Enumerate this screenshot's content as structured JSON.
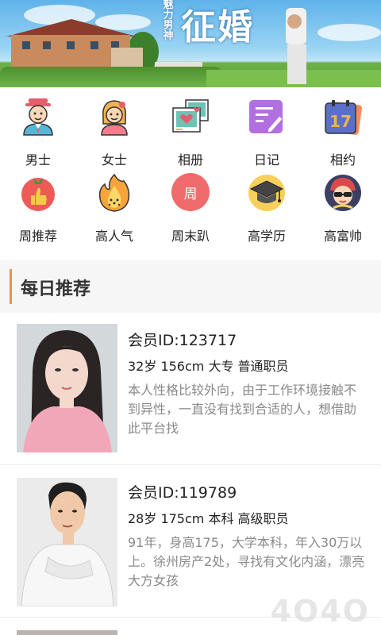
{
  "banner": {
    "subtitle": "魅力男神",
    "title": "征婚"
  },
  "categories": [
    {
      "label": "男士",
      "icon": "man-icon"
    },
    {
      "label": "女士",
      "icon": "woman-icon"
    },
    {
      "label": "相册",
      "icon": "photo-album-icon"
    },
    {
      "label": "日记",
      "icon": "diary-icon"
    },
    {
      "label": "相约",
      "icon": "date-calendar-icon"
    },
    {
      "label": "周推荐",
      "icon": "thumbs-up-tomato-icon"
    },
    {
      "label": "高人气",
      "icon": "popular-flame-icon"
    },
    {
      "label": "周末趴",
      "icon": "weekend-party-icon",
      "glyph": "周"
    },
    {
      "label": "高学历",
      "icon": "graduation-cap-icon"
    },
    {
      "label": "高富帅",
      "icon": "rich-handsome-icon"
    }
  ],
  "section": {
    "title": "每日推荐"
  },
  "members": [
    {
      "id_text": "会员ID:123717",
      "stats": "32岁 156cm 大专 普通职员",
      "desc": "本人性格比较外向，由于工作环境接触不到异性，一直没有找到合适的人，想借助此平台找"
    },
    {
      "id_text": "会员ID:119789",
      "stats": "28岁 175cm 本科 高级职员",
      "desc": "91年，身高175，大学本科，年入30万以上。徐州房产2处，寻找有文化内涵，漂亮大方女孩"
    }
  ],
  "watermark": "4O4O",
  "colors": {
    "accent": "#f19148",
    "desc_text": "#8a8a8a",
    "section_bg": "#f6f6f6"
  }
}
